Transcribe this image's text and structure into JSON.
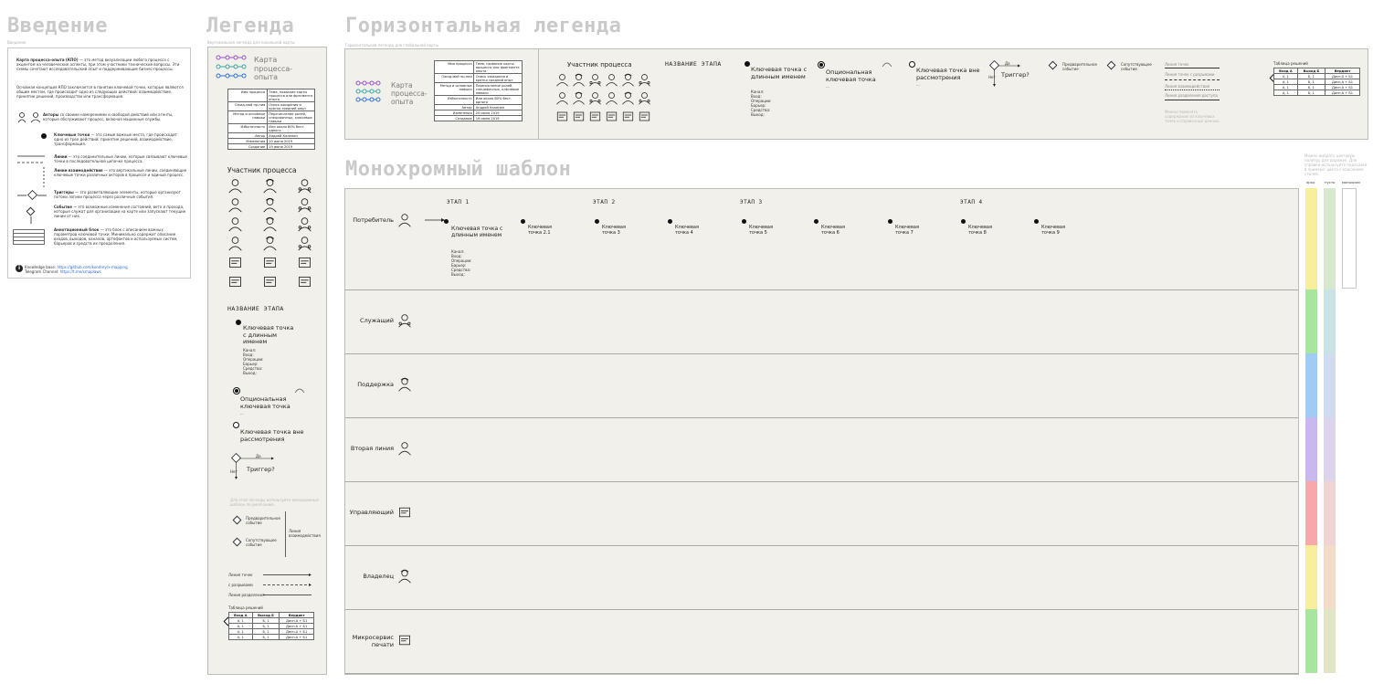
{
  "headings": {
    "intro": "Введение",
    "legend": "Легенда",
    "horizontal": "Горизонтальная легенда",
    "mono": "Монохромный шаблон"
  },
  "subtitles": {
    "intro": "Введение",
    "legend": "Вертикальная легенда для локальной карты",
    "horizontal": "Горизонтальная легенда для глобальной карты"
  },
  "intro": {
    "para1_bold": "Карта процесса-опыта (КПО)",
    "para1": " — это метод визуализации любого процесса с акцентом на человеческие аспекты, при этом участники технические вопросы. Эти схемы сочетают исследовательский опыт и поддерживающие бизнес-процессы.",
    "para2": "Основная концепция КПО заключается в понятии ключевой точки, которые являются общим местом, где происходит одно из следующих действий: взаимодействие, принятие решений, производство или трансформация.",
    "items": [
      {
        "bold": "Акторы",
        "text": " со своими намерениями и свободой действий или агенты, которые обслуживают процесс, включая машинные службы."
      },
      {
        "bold": "Ключевые точки",
        "text": " — это самые важные места, где происходит одно из трех действий: принятие решений, взаимодействие, трансформация."
      },
      {
        "bold": "Линии",
        "text": " — это соединительные линии, которые связывают ключевые точки в последовательной цепочке процесса."
      },
      {
        "bold": "Линии взаимодействия",
        "text": " — это вертикальные линии, соединяющие ключевые точки различных акторов в процессе и единый процесс."
      },
      {
        "bold": "Триггеры",
        "text": " — это разветвляющие элементы, которые организуют потоки логики процесса через различные события."
      },
      {
        "bold": "События",
        "text": " — это возможные изменения состояний, вето и прохода, которые служат для организации на карте или запускают текущие линии от них."
      },
      {
        "bold": "Аннотационный блок",
        "text": " — это блок с описанием важных параметров ключевой точки. Минимально содержит описание входов, выходов, каналов, артефактов и используемых систем, барьеров и средств их преодоления."
      }
    ],
    "kb_label": "Knowledge base:",
    "kb_link": "https://github.com/kondrey/x-mapping",
    "tg_label": "Telegram Channel:",
    "tg_link": "https://t.me/xmaplaws"
  },
  "legend": {
    "title": "Карта процесса-опыта",
    "info_table": [
      [
        "Имя процесса",
        "Тема, название карты процесса или фрагмента опыта"
      ],
      [
        "Ожид-мой пр-ния",
        "Опись ожидания и кратко средний опыт"
      ],
      [
        "Метод и основные навыки",
        "Перечисление ролей, специфичных, ключевые навыки"
      ],
      [
        "Избыточность",
        "Или около 80% бест-одного"
      ],
      [
        "Автор",
        "Андрей Каленин"
      ],
      [
        "Изменения",
        "20 июня 2019"
      ],
      [
        "Создание",
        "19 июня 2019"
      ]
    ],
    "participants_title": "Участник процесса",
    "stage_name": "НАЗВАНИЕ ЭТАПА",
    "kp_long": "Ключевая точка с длинным именем",
    "kp_fields": [
      "Канал:",
      "Вход:",
      "Операции:",
      "Барьер:",
      "Средства:",
      "Выход:"
    ],
    "kp_optional": "Опциональная ключевая точка",
    "kp_outside": "Ключевая точка вне рассмотрения",
    "trigger": "Триггер?",
    "trigger_yes": "Да",
    "trigger_no": "Нет",
    "event_before": "Предварительное событие",
    "event_after": "Сопутствующее событие",
    "interaction_line": "Линия взаимодействия",
    "line_main": "Линия точек",
    "line_break": "с разрывами",
    "line_divider": "Линия разделения",
    "decision_table_title": "Таблица решений",
    "decision_headers": [
      "Вход А",
      "Выход Б",
      "Вердикт"
    ],
    "decision_rows": [
      [
        "А, 1",
        "Б, 1",
        "Дисп.А + Б1"
      ],
      [
        "А, 1",
        "Б, 1",
        "Дисп.А + Б1"
      ],
      [
        "А, 1",
        "Б, 1",
        "Дисп.А + Б1"
      ],
      [
        "А, 1",
        "Б, 1",
        "Дисп.А + Б1"
      ]
    ],
    "faint_note": "Для этой легенды используйте монохромный шаблон по умолчанию."
  },
  "horizontal": {
    "participants_title": "Участник процесса",
    "stage_name": "НАЗВАНИЕ ЭТАПА",
    "kp_long": "Ключевая точка с длинным именем",
    "kp_fields": [
      "Канал:",
      "Вход:",
      "Операции:",
      "Барьер:",
      "Средства:",
      "Выход:"
    ],
    "kp_optional": "Опциональная ключевая точка",
    "kp_outside": "Ключевая точка вне рассмотрения",
    "trigger": "Триггер?",
    "event_before": "Предварительное событие",
    "event_after": "Сопутствующее событие",
    "lines": [
      "Линия точек",
      "Линия точек с разрывами",
      "Линия взаимодействия",
      "Линия разделения доступа"
    ],
    "faint_note": "Можно поменять содержание из ключевых точек и справочных данных."
  },
  "mono": {
    "stages": [
      "ЭТАП 1",
      "ЭТАП 2",
      "ЭТАП 3",
      "ЭТАП 4"
    ],
    "lanes": [
      "Потребитель",
      "Служащий",
      "Поддержка",
      "Вторая линия",
      "Управляющий",
      "Владелец",
      "Микросервис печати"
    ],
    "first_kp": "Ключевая точка с длинным именем",
    "first_kp_fields": [
      "Канал:",
      "Вход:",
      "Операции:",
      "Барьер:",
      "Средства:",
      "Выход:"
    ],
    "kps": [
      "Ключевая точка 2.1",
      "Ключевая точка 3",
      "Ключевая точка 4",
      "Ключевая точка 5",
      "Ключевая точка 6",
      "Ключевая точка 7",
      "Ключевая точка 8",
      "Ключевая точка 9"
    ]
  },
  "palette": {
    "note": "Можно выбрать цветовую палитру для дорожек. Для справки используйте подсказки в примере: цвета с описанием стилей.",
    "columns": [
      "ярко",
      "пусто",
      "монохром"
    ],
    "bright": [
      "#f9ee9c",
      "#a8e6a0",
      "#9fcbf5",
      "#c9b8f0",
      "#f7a8ab",
      "#f9ee9c",
      "#a8e6a0"
    ],
    "pale": [
      "#d8e8cf",
      "#c9e3e5",
      "#cfdbee",
      "#ddd3ea",
      "#f1d3d3",
      "#f2dcc7",
      "#e0e5c7"
    ]
  }
}
